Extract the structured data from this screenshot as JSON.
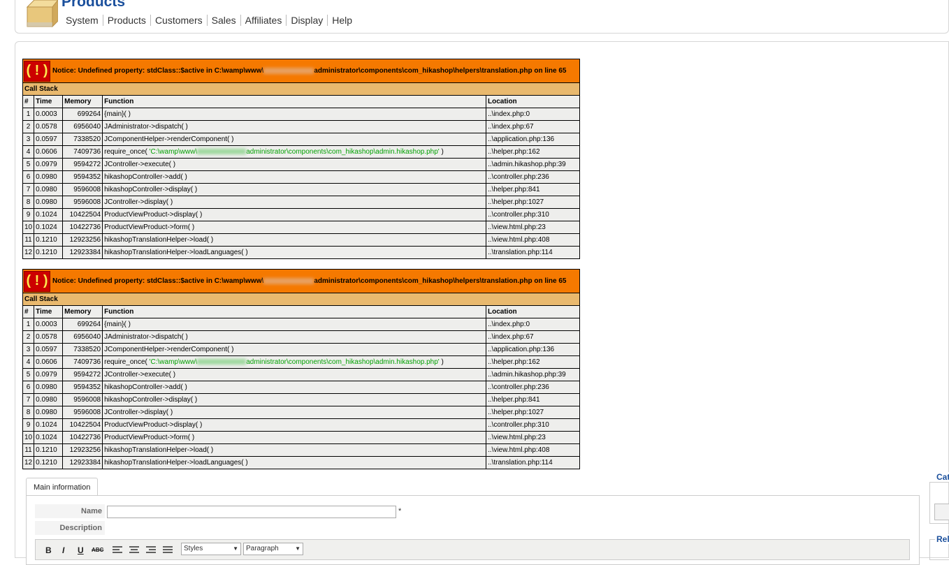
{
  "header": {
    "title": "Products",
    "menu": [
      "System",
      "Products",
      "Customers",
      "Sales",
      "Affiliates",
      "Display",
      "Help"
    ]
  },
  "errors": [
    {
      "notice_prefix": "Notice: Undefined property: stdClass::$active in C:\\wamp\\www\\",
      "notice_suffix": "administrator\\components\\com_hikashop\\helpers\\translation.php on line 65",
      "call_stack_label": "Call Stack",
      "columns": [
        "#",
        "Time",
        "Memory",
        "Function",
        "Location"
      ],
      "rows": [
        [
          "1",
          "0.0003",
          "699264",
          "{main}( )",
          "..\\index.php:0"
        ],
        [
          "2",
          "0.0578",
          "6956040",
          "JAdministrator->dispatch( )",
          "..\\index.php:67"
        ],
        [
          "3",
          "0.0597",
          "7338520",
          "JComponentHelper->renderComponent( )",
          "..\\application.php:136"
        ],
        [
          "4",
          "0.0606",
          "7409736",
          "require_once( 'C:\\wamp\\www\\",
          "..\\helper.php:162"
        ],
        [
          "5",
          "0.0979",
          "9594272",
          "JController->execute( )",
          "..\\admin.hikashop.php:39"
        ],
        [
          "6",
          "0.0980",
          "9594352",
          "hikashopController->add( )",
          "..\\controller.php:236"
        ],
        [
          "7",
          "0.0980",
          "9596008",
          "hikashopController->display( )",
          "..\\helper.php:841"
        ],
        [
          "8",
          "0.0980",
          "9596008",
          "JController->display( )",
          "..\\helper.php:1027"
        ],
        [
          "9",
          "0.1024",
          "10422504",
          "ProductViewProduct->display( )",
          "..\\controller.php:310"
        ],
        [
          "10",
          "0.1024",
          "10422736",
          "ProductViewProduct->form( )",
          "..\\view.html.php:23"
        ],
        [
          "11",
          "0.1210",
          "12923256",
          "hikashopTranslationHelper->load( )",
          "..\\view.html.php:408"
        ],
        [
          "12",
          "0.1210",
          "12923384",
          "hikashopTranslationHelper->loadLanguages( )",
          "..\\translation.php:114"
        ]
      ],
      "row4_path_suffix": "administrator\\components\\com_hikashop\\admin.hikashop.php' )"
    },
    {
      "notice_prefix": "Notice: Undefined property: stdClass::$active in C:\\wamp\\www\\",
      "notice_suffix": "administrator\\components\\com_hikashop\\helpers\\translation.php on line 65",
      "call_stack_label": "Call Stack",
      "columns": [
        "#",
        "Time",
        "Memory",
        "Function",
        "Location"
      ],
      "rows": [
        [
          "1",
          "0.0003",
          "699264",
          "{main}( )",
          "..\\index.php:0"
        ],
        [
          "2",
          "0.0578",
          "6956040",
          "JAdministrator->dispatch( )",
          "..\\index.php:67"
        ],
        [
          "3",
          "0.0597",
          "7338520",
          "JComponentHelper->renderComponent( )",
          "..\\application.php:136"
        ],
        [
          "4",
          "0.0606",
          "7409736",
          "require_once( 'C:\\wamp\\www\\",
          "..\\helper.php:162"
        ],
        [
          "5",
          "0.0979",
          "9594272",
          "JController->execute( )",
          "..\\admin.hikashop.php:39"
        ],
        [
          "6",
          "0.0980",
          "9594352",
          "hikashopController->add( )",
          "..\\controller.php:236"
        ],
        [
          "7",
          "0.0980",
          "9596008",
          "hikashopController->display( )",
          "..\\helper.php:841"
        ],
        [
          "8",
          "0.0980",
          "9596008",
          "JController->display( )",
          "..\\helper.php:1027"
        ],
        [
          "9",
          "0.1024",
          "10422504",
          "ProductViewProduct->display( )",
          "..\\controller.php:310"
        ],
        [
          "10",
          "0.1024",
          "10422736",
          "ProductViewProduct->form( )",
          "..\\view.html.php:23"
        ],
        [
          "11",
          "0.1210",
          "12923256",
          "hikashopTranslationHelper->load( )",
          "..\\view.html.php:408"
        ],
        [
          "12",
          "0.1210",
          "12923384",
          "hikashopTranslationHelper->loadLanguages( )",
          "..\\translation.php:114"
        ]
      ],
      "row4_path_suffix": "administrator\\components\\com_hikashop\\admin.hikashop.php' )"
    }
  ],
  "form": {
    "tab_label": "Main information",
    "name_label": "Name",
    "name_value": "",
    "required_mark": "*",
    "description_label": "Description",
    "editor": {
      "bold": "B",
      "italic": "I",
      "underline": "U",
      "strike": "ABC",
      "styles_value": "Styles",
      "format_value": "Paragraph"
    }
  },
  "side": {
    "categories_legend": "Cat",
    "related_legend": "Rela"
  },
  "colors": {
    "notice_bg": "#f57900",
    "stack_header_bg": "#e9b96e",
    "cell_bg": "#eeeeec",
    "error_icon_bg": "#cc0000",
    "title_blue": "#1a4f9c"
  }
}
